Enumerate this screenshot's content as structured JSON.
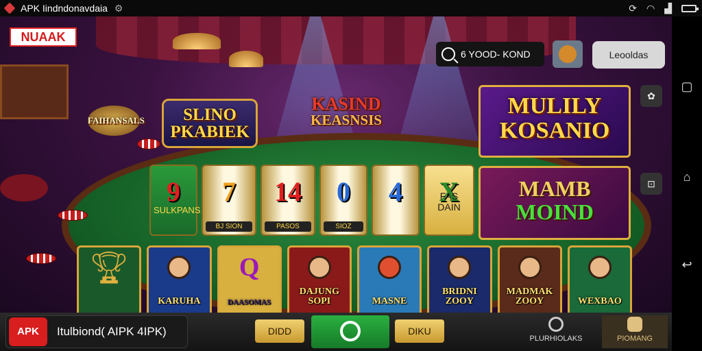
{
  "status_bar": {
    "title": "APK Iindndonavdaia",
    "gear_icon": "gear-icon",
    "right_icons": [
      "sync-icon",
      "wifi-icon",
      "signal-icon",
      "battery-icon"
    ]
  },
  "top": {
    "logo_text": "NUAAK",
    "search_text": "6 YOOD- KOND",
    "right_button_label": "Leooldas"
  },
  "scene": {
    "sign_left": {
      "line1": "SLINO",
      "line2": "PKABIEK"
    },
    "sign_small": "FAIHANSALS",
    "sign_center": {
      "line1": "KASIND",
      "line2": "KEASNSIS"
    }
  },
  "banners": [
    {
      "line1": "MULILY",
      "line2": "KOSANIO"
    },
    {
      "line1": "MAMB",
      "line2": "MOIND"
    }
  ],
  "reels": [
    {
      "symbol": "9",
      "label": "SULKPANS",
      "color": "#e02020"
    },
    {
      "symbol": "7",
      "label": "BJ SION",
      "color": "#f0a020"
    },
    {
      "symbol": "14",
      "label": "PASOS",
      "color": "#e02020"
    },
    {
      "symbol": "0",
      "label": "SIOZ",
      "color": "#2a6ad8"
    },
    {
      "symbol": "4",
      "label": "",
      "color": "#2a6ad8"
    },
    {
      "symbol": "X",
      "label": "FAS DAIN",
      "color": "#2a8a2a"
    }
  ],
  "tiles": [
    {
      "name": "",
      "bg": "#1a5a2a"
    },
    {
      "name": "KARUHA",
      "bg": "#1a3a8a"
    },
    {
      "name": "DAASOMAS",
      "bg": "#d8b040"
    },
    {
      "name": "DAJUNG SOPI",
      "bg": "#8a1a1a"
    },
    {
      "name": "MASNE",
      "bg": "#2a7ab8"
    },
    {
      "name": "BRIDNI ZOOY",
      "bg": "#1a2a6a"
    },
    {
      "name": "MADMAK ZOOY",
      "bg": "#5a2a1a"
    },
    {
      "name": "WEXBAO",
      "bg": "#1a6a3a"
    }
  ],
  "bottom_bar": {
    "apk_badge": "APK",
    "apk_text": "Itulbiond( AIPK 4IPK)",
    "btn_left": "DIDD",
    "btn_right": "DIKU",
    "tool1": "PLURHIOLAKS",
    "tool2": "PIOMANG"
  },
  "colors": {
    "accent_gold": "#d9a53a",
    "felt_green": "#2b8a3e",
    "apk_red": "#d81e1e"
  }
}
